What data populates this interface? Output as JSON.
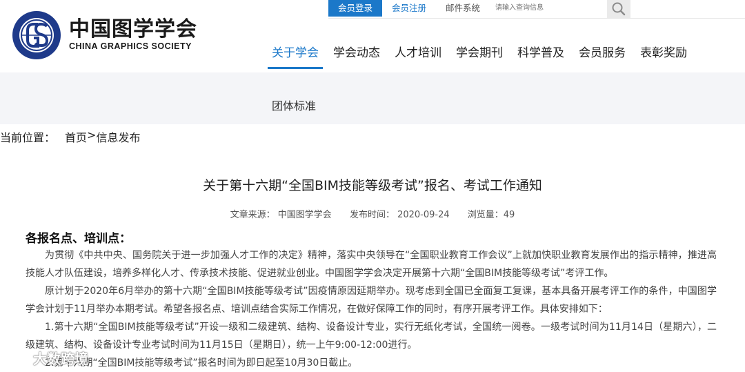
{
  "logo": {
    "cn": "中国图学学会",
    "en": "CHINA GRAPHICS SOCIETY",
    "ring_text": "CHINA GRAPHICS SOCIETY"
  },
  "topbar": {
    "login": "会员登录",
    "register": "会员注册",
    "mail": "邮件系统",
    "search_placeholder": "请输入查询信息",
    "search_icon": "search-icon"
  },
  "nav": {
    "items": [
      "关于学会",
      "学会动态",
      "人才培训",
      "学会期刊",
      "科学普及",
      "会员服务",
      "表彰奖励"
    ]
  },
  "subnav": {
    "item": "团体标准"
  },
  "breadcrumb": {
    "label": "当前位置：",
    "home": "首页",
    "sep": ">",
    "current": "信息发布"
  },
  "article": {
    "title": "关于第十六期“全国BIM技能等级考试”报名、考试工作通知",
    "meta": {
      "source": "文章来源： 中国图学学会",
      "date": "发布时间： 2020-09-24",
      "views": "浏览量：49"
    },
    "section_heading": "各报名点、培训点：",
    "paragraphs": [
      "为贯彻《中共中央、国务院关于进一步加强人才工作的决定》精神，落实中央领导在“全国职业教育工作会议”上就加快职业教育发展作出的指示精神，推进高技能人才队伍建设，培养多样化人才、传承技术技能、促进就业创业。中国图学学会决定开展第十六期“全国BIM技能等级考试”考评工作。",
      "原计划于2020年6月举办的第十六期“全国BIM技能等级考试”因疫情原因延期举办。现考虑到全国已全面复工复课，基本具备开展考评工作的条件，中国图学学会计划于11月举办本期考试。希望各报名点、培训点结合实际工作情况，在做好保障工作的同时，有序开展考评工作。具体安排如下：",
      "1.第十六期“全国BIM技能等级考试”开设一级和二级建筑、结构、设备设计专业，实行无纸化考试，全国统一阅卷。一级考试时间为11月14日（星期六），二级建筑、结构、设备设计专业考试时间为11月15日（星期日），统一上午9:00-12:00进行。",
      "2.第十六期“全国BIM技能等级考试”报名时间为即日起至10月30日截止。"
    ]
  },
  "watermark": {
    "text": "大数跨境"
  },
  "colors": {
    "accent": "#1b78c9",
    "subbar_bg": "#f4f5f8"
  }
}
